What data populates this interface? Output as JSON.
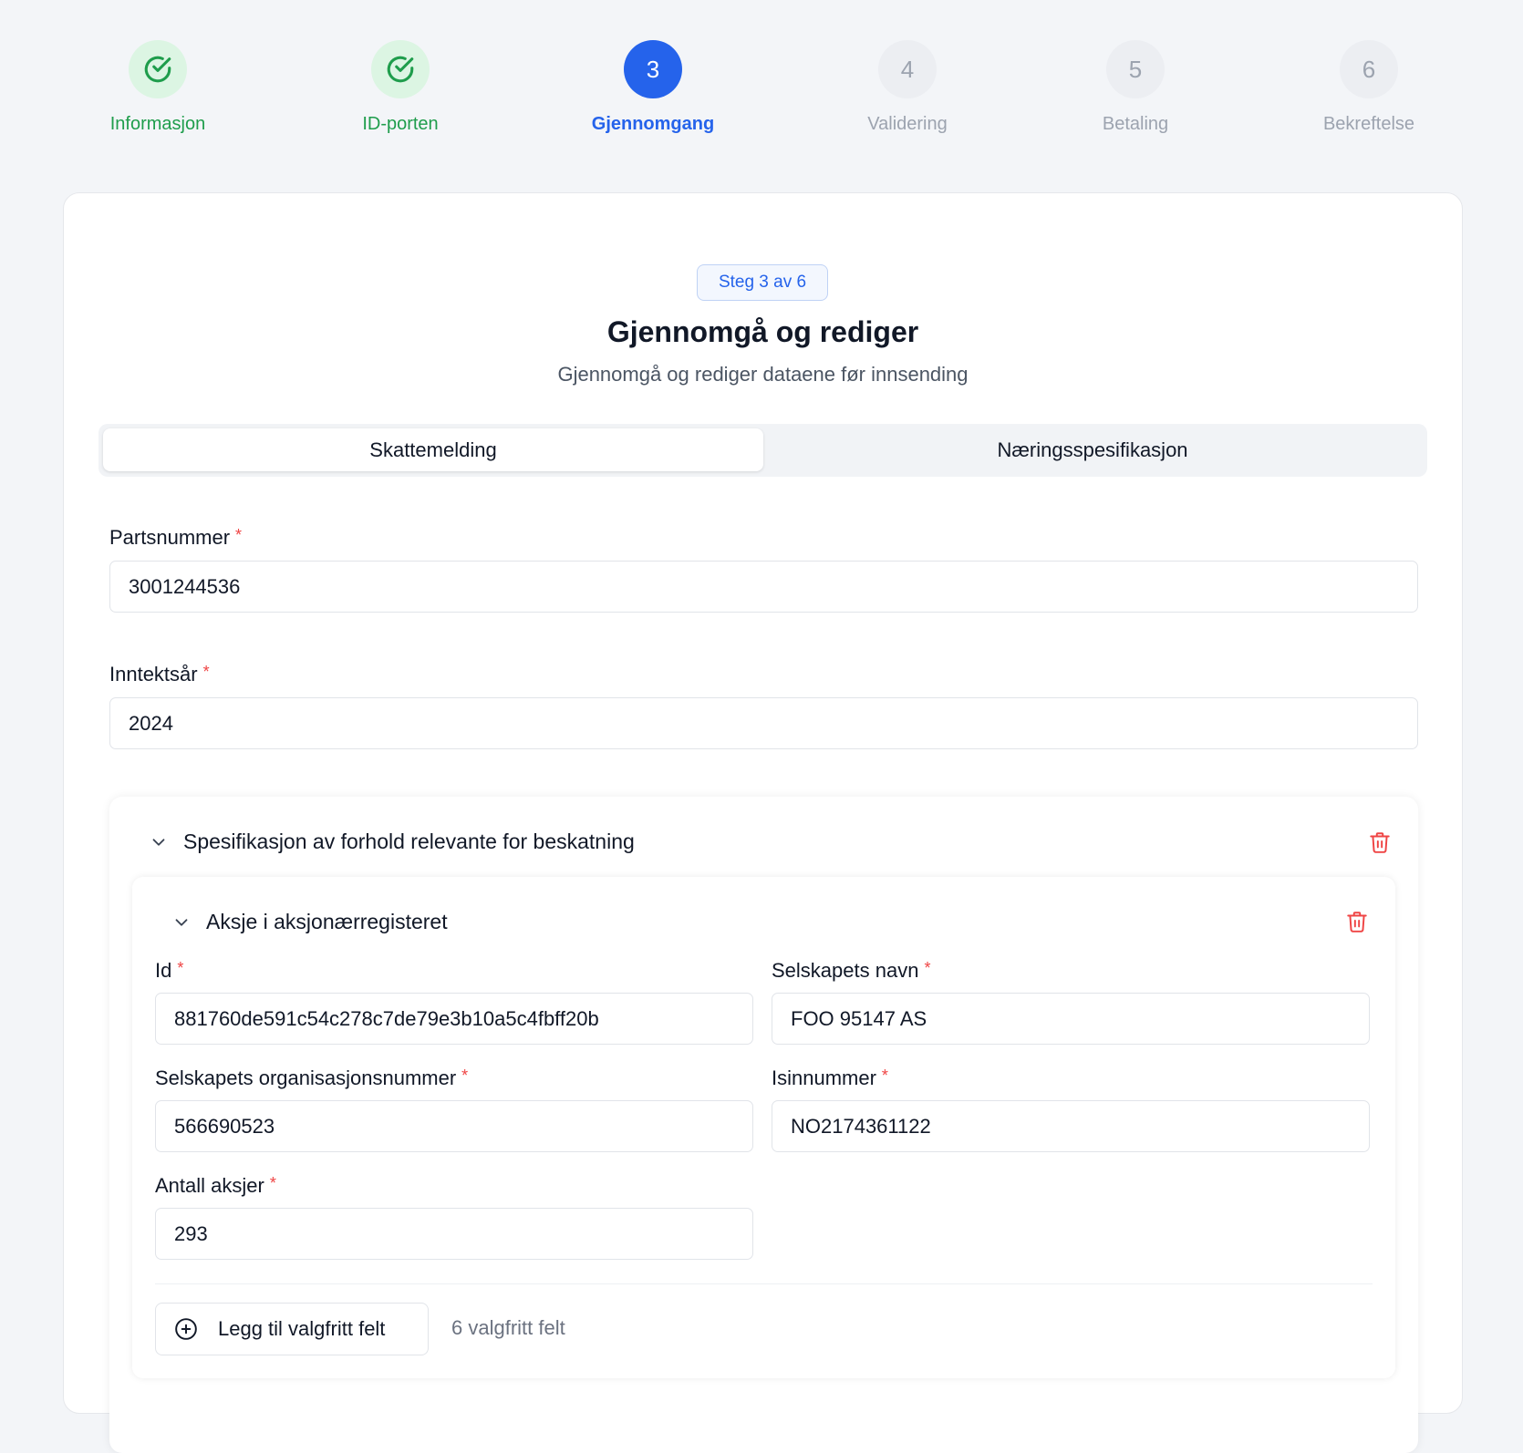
{
  "stepper": {
    "steps": [
      {
        "number": "1",
        "label": "Informasjon",
        "state": "done"
      },
      {
        "number": "2",
        "label": "ID-porten",
        "state": "done"
      },
      {
        "number": "3",
        "label": "Gjennomgang",
        "state": "active"
      },
      {
        "number": "4",
        "label": "Validering",
        "state": "pending"
      },
      {
        "number": "5",
        "label": "Betaling",
        "state": "pending"
      },
      {
        "number": "6",
        "label": "Bekreftelse",
        "state": "pending"
      }
    ]
  },
  "header": {
    "badge": "Steg 3 av 6",
    "title": "Gjennomgå og rediger",
    "subtitle": "Gjennomgå og rediger dataene før innsending"
  },
  "tabs": [
    {
      "label": "Skattemelding",
      "active": true
    },
    {
      "label": "Næringsspesifikasjon",
      "active": false
    }
  ],
  "fields": {
    "partsnummer": {
      "label": "Partsnummer",
      "value": "3001244536"
    },
    "inntektsar": {
      "label": "Inntektsår",
      "value": "2024"
    }
  },
  "required_marker": "*",
  "outer_section": {
    "title": "Spesifikasjon av forhold relevante for beskatning"
  },
  "inner_section": {
    "title": "Aksje i aksjonærregisteret",
    "fields": {
      "id": {
        "label": "Id",
        "value": "881760de591c54c278c7de79e3b10a5c4fbff20b"
      },
      "selskapets_navn": {
        "label": "Selskapets navn",
        "value": "FOO 95147 AS"
      },
      "orgnr": {
        "label": "Selskapets organisasjonsnummer",
        "value": "566690523"
      },
      "isinnummer": {
        "label": "Isinnummer",
        "value": "NO2174361122"
      },
      "antall_aksjer": {
        "label": "Antall aksjer",
        "value": "293"
      }
    },
    "add_button": "Legg til valgfritt felt",
    "optional_count": "6 valgfritt felt"
  },
  "colors": {
    "primary": "#2563eb",
    "success": "#1f9d4c",
    "success_bg": "#dcf5e3",
    "danger": "#ef4444",
    "muted": "#9ca3af"
  },
  "icons": {
    "done_step": "check-circle-icon",
    "collapse": "chevron-down-icon",
    "delete": "trash-icon",
    "add": "plus-circle-icon"
  }
}
